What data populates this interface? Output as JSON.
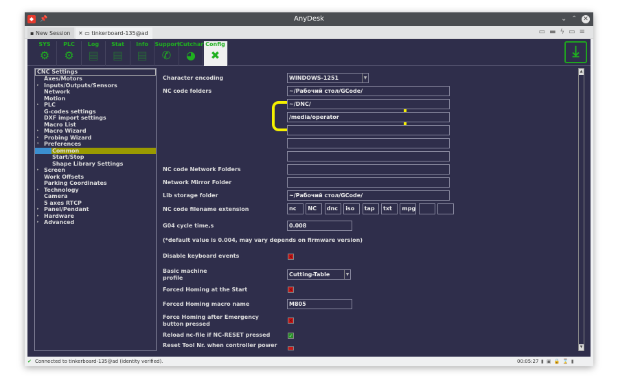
{
  "window": {
    "title": "AnyDesk"
  },
  "tabs": [
    {
      "label": "New Session"
    },
    {
      "label": "tinkerboard-135@ad"
    }
  ],
  "toolbar": {
    "tabs": [
      {
        "label": "SYS",
        "icon": "gear-icon"
      },
      {
        "label": "PLC",
        "icon": "gear-icon"
      },
      {
        "label": "Log",
        "icon": "document-icon"
      },
      {
        "label": "Stat",
        "icon": "document-icon"
      },
      {
        "label": "Info",
        "icon": "document-icon"
      },
      {
        "label": "Support",
        "icon": "phone-icon"
      },
      {
        "label": "Cutchart",
        "icon": "pie-chart-icon"
      },
      {
        "label": "Config",
        "icon": "tools-icon",
        "active": true
      }
    ],
    "download_icon": "download-icon"
  },
  "tree": {
    "header": "CNC Settings",
    "items": [
      {
        "label": "Axes/Motors",
        "level": 1
      },
      {
        "label": "Inputs/Outputs/Sensors",
        "level": 1,
        "arrow": "▸"
      },
      {
        "label": "Network",
        "level": 1
      },
      {
        "label": "Motion",
        "level": 1
      },
      {
        "label": "PLC",
        "level": 1,
        "arrow": "▸"
      },
      {
        "label": "G-codes settings",
        "level": 1
      },
      {
        "label": "DXF import settings",
        "level": 1
      },
      {
        "label": "Macro List",
        "level": 1
      },
      {
        "label": "Macro Wizard",
        "level": 1,
        "arrow": "▸"
      },
      {
        "label": "Probing Wizard",
        "level": 1,
        "arrow": "▸"
      },
      {
        "label": "Preferences",
        "level": 1,
        "arrow": "▾"
      },
      {
        "label": "Common",
        "level": 2,
        "selected": true
      },
      {
        "label": "Start/Stop",
        "level": 2
      },
      {
        "label": "Shape Library Settings",
        "level": 2
      },
      {
        "label": "Screen",
        "level": 1,
        "arrow": "▸"
      },
      {
        "label": "Work Offsets",
        "level": 1
      },
      {
        "label": "Parking Coordinates",
        "level": 1
      },
      {
        "label": "Technology",
        "level": 1,
        "arrow": "▸"
      },
      {
        "label": "Camera",
        "level": 1
      },
      {
        "label": "5 axes RTCP",
        "level": 1
      },
      {
        "label": "Panel/Pendant",
        "level": 1,
        "arrow": "▸"
      },
      {
        "label": "Hardware",
        "level": 1,
        "arrow": "▸"
      },
      {
        "label": "Advanced",
        "level": 1,
        "arrow": "▸"
      }
    ]
  },
  "form": {
    "char_encoding": {
      "label": "Character encoding",
      "value": "WINDOWS-1251"
    },
    "nc_folders": {
      "label": "NC code folders",
      "values": [
        "~/Рабочий стол/GCode/",
        "~/DNC/",
        "/media/operator",
        "",
        "",
        ""
      ]
    },
    "network_folders": {
      "label": "NC code Network Folders",
      "value": ""
    },
    "mirror_folder": {
      "label": "Network Mirror Folder",
      "value": ""
    },
    "lib_folder": {
      "label": "Lib storage folder",
      "value": "~/Рабочий стол/GCode/"
    },
    "extensions": {
      "label": "NC code filename extension",
      "values": [
        "nc",
        "NC",
        "dnc",
        "iso",
        "tap",
        "txt",
        "mpg",
        "",
        ""
      ]
    },
    "g04": {
      "label": "G04 cycle time,s",
      "value": "0.008"
    },
    "note": "(*default value is 0.004, may vary depends on firmware version)",
    "disable_keyboard": {
      "label": "Disable keyboard events",
      "checked": false
    },
    "machine_profile": {
      "label1": "Basic machine",
      "label2": "profile",
      "value": "Cutting-Table"
    },
    "forced_homing": {
      "label": "Forced Homing at the Start",
      "checked": false
    },
    "homing_macro": {
      "label": "Forced Homing macro name",
      "value": "M805"
    },
    "force_homing_emergency": {
      "label1": "Force Homing after Emergency",
      "label2": "button pressed",
      "checked": false
    },
    "reload_nc": {
      "label": "Reload nc-file if NC-RESET pressed",
      "checked": true
    },
    "reset_tool": {
      "label": "Reset Tool Nr. when controller power",
      "checked": false
    }
  },
  "status": {
    "text": "Connected to tinkerboard-135@ad (identity verified).",
    "time": "00:05:27"
  },
  "colors": {
    "accent": "#1fb01f",
    "bg": "#2f2e4b",
    "highlight": "#f5f000",
    "selected": "#9a9a00"
  }
}
